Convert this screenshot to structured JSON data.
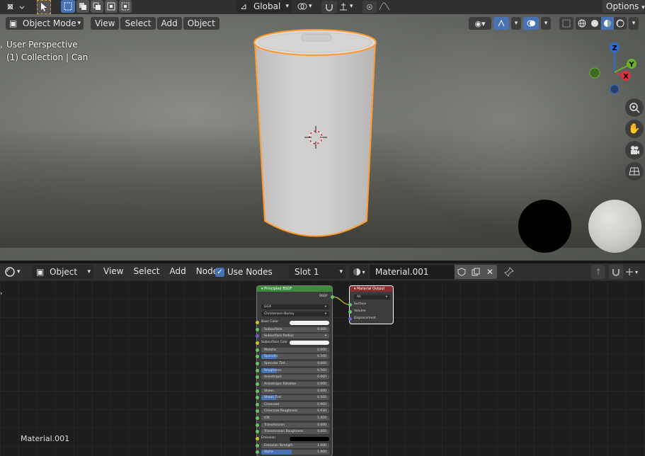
{
  "colors": {
    "accent": "#4772b3",
    "header_bg": "#303030",
    "selection_outline": "#ff9a2e",
    "node_shader_header": "#3c8a3c",
    "node_output_header": "#8a2d2d"
  },
  "top_toolbar": {
    "transform_orientation": "Global",
    "options_label": "Options"
  },
  "viewport": {
    "mode": "Object Mode",
    "menus": [
      "View",
      "Select",
      "Add",
      "Object"
    ],
    "info_line1": "User Perspective",
    "info_line2": "(1) Collection | Can",
    "gizmo_axes": {
      "x": "X",
      "y": "Y",
      "z": "Z"
    }
  },
  "node_editor": {
    "editor_type": "Object",
    "menus": [
      "View",
      "Select",
      "Add",
      "Node"
    ],
    "use_nodes_label": "Use Nodes",
    "use_nodes_checked": true,
    "slot": "Slot 1",
    "material_name": "Material.001",
    "footer_label": "Material.001",
    "principled": {
      "title": "Principled BSDF",
      "output": "BSDF",
      "distribution": "GGX",
      "subsurface_method": "Christensen-Burley",
      "rows": [
        {
          "label": "Base Color",
          "value": "",
          "kind": "color",
          "color": "#f2f2f2",
          "sock": "y"
        },
        {
          "label": "Subsurface",
          "value": "0.000",
          "kind": "num",
          "sock": "g"
        },
        {
          "label": "Subsurface Radius",
          "value": "",
          "kind": "vec",
          "sock": "p"
        },
        {
          "label": "Subsurface Colo",
          "value": "",
          "kind": "color",
          "color": "#f2f2f2",
          "sock": "y"
        },
        {
          "label": "Metallic",
          "value": "0.000",
          "kind": "num",
          "sock": "g"
        },
        {
          "label": "Specular",
          "value": "0.500",
          "kind": "num",
          "fill": 0.5,
          "sock": "g"
        },
        {
          "label": "Specular Tint",
          "value": "0.000",
          "kind": "num",
          "sock": "g"
        },
        {
          "label": "Roughness",
          "value": "0.500",
          "kind": "num",
          "fill": 0.5,
          "sock": "g"
        },
        {
          "label": "Anisotropic",
          "value": "0.000",
          "kind": "num",
          "sock": "g"
        },
        {
          "label": "Anisotropic Rotation",
          "value": "0.000",
          "kind": "num",
          "sock": "g"
        },
        {
          "label": "Sheen",
          "value": "0.000",
          "kind": "num",
          "sock": "g"
        },
        {
          "label": "Sheen Tint",
          "value": "0.500",
          "kind": "num",
          "fill": 0.5,
          "sock": "g"
        },
        {
          "label": "Clearcoat",
          "value": "0.000",
          "kind": "num",
          "sock": "g"
        },
        {
          "label": "Clearcoat Roughness",
          "value": "0.030",
          "kind": "num",
          "sock": "g"
        },
        {
          "label": "IOR",
          "value": "1.450",
          "kind": "num",
          "sock": "g"
        },
        {
          "label": "Transmission",
          "value": "0.000",
          "kind": "num",
          "sock": "g"
        },
        {
          "label": "Transmission Roughness",
          "value": "0.000",
          "kind": "num",
          "sock": "g"
        },
        {
          "label": "Emission",
          "value": "",
          "kind": "color",
          "color": "#000000",
          "sock": "y"
        },
        {
          "label": "Emission Strength",
          "value": "1.000",
          "kind": "num",
          "sock": "g"
        },
        {
          "label": "Alpha",
          "value": "1.000",
          "kind": "num",
          "fill": 1.0,
          "sock": "g"
        }
      ]
    },
    "output_node": {
      "title": "Material Output",
      "target": "All",
      "inputs": [
        "Surface",
        "Volume",
        "Displacement"
      ]
    }
  }
}
